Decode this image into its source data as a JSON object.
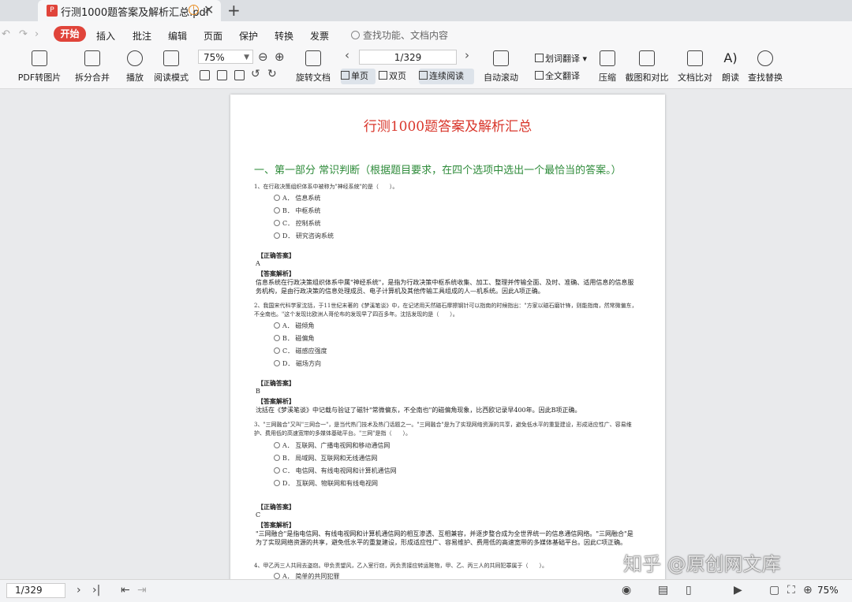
{
  "tab": {
    "title": "行测1000题答案及解析汇总.pdf",
    "pdf_icon": "P",
    "warn_icon": "!",
    "close_icon": "✕",
    "new_tab_icon": "+"
  },
  "menu": {
    "start": "开始",
    "items": [
      "插入",
      "批注",
      "编辑",
      "页面",
      "保护",
      "转换",
      "发票"
    ],
    "search_placeholder": "查找功能、文档内容"
  },
  "toolbar": {
    "pdf_to_image": "PDF转图片",
    "split_merge": "拆分合并",
    "play": "播放",
    "read_mode": "阅读模式",
    "zoom": "75%",
    "rotate_doc": "旋转文档",
    "page_indicator": "1/329",
    "single_page": "单页",
    "double_page": "双页",
    "continuous": "连续阅读",
    "auto_scroll": "自动滚动",
    "word_translate": "划词翻译",
    "full_translate": "全文翻译",
    "compress": "压缩",
    "screenshot_compare": "截图和对比",
    "doc_compare": "文档比对",
    "read_aloud": "朗读",
    "find_replace": "查找替换"
  },
  "document": {
    "title": "行测1000题答案及解析汇总",
    "section": "一、第一部分 常识判断（根据题目要求，在四个选项中选出一个最恰当的答案。）",
    "answer_label": "【正确答案】",
    "explain_label": "【答案解析】",
    "questions": [
      {
        "text": "1、在行政决策组织体系中被称为\"神经系统\"的是（　　）。",
        "options": [
          "A． 信息系统",
          "B． 中枢系统",
          "C． 控制系统",
          "D． 研究咨询系统"
        ],
        "answer": "A",
        "explanation": "信息系统在行政决策组织体系中属\"神经系统\"，是指为行政决策中枢系统收集、加工、整理并传输全面、及时、准确、适用信息的信息服务机构，是由行政决策的信息处理成员、电子计算机及其他传输工具组成的人—机系统。因此A项正确。"
      },
      {
        "text": "2、我国宋代科学家沈括，于11世纪末著的《梦溪笔谈》中，在记述用天然磁石摩擦钢针可以指南的时候指出：\"方家以磁石磨针锋，则能指南，然常微偏东，不全南也。\"这个发现比欧洲人哥伦布的发现早了四百多年。沈括发现的是（　　）。",
        "options": [
          "A． 磁倾角",
          "B． 磁偏角",
          "C． 磁感应强度",
          "D． 磁场方向"
        ],
        "answer": "B",
        "explanation": "沈括在《梦溪笔谈》中记载与验证了磁针\"常微偏东，不全南也\"的磁偏角现象，比西欧记录早400年。因此B项正确。"
      },
      {
        "text": "3、\"三网融合\"又叫\"三网合一\"，是当代热门技术及热门话题之一。\"三网融合\"是为了实现网络资源的共享，避免低水平的重复建设，形成适应性广、容易维护、费用低的高速宽带的多媒体基础平台。\"三网\"是指（　　）。",
        "options": [
          "A． 互联网、广播电视网和移动通信网",
          "B． 局域网、互联网和无线通信网",
          "C． 电信网、有线电视网和计算机通信网",
          "D． 互联网、物联网和有线电视网"
        ],
        "answer": "C",
        "explanation": "\"三网融合\"是指电信网、有线电视网和计算机通信网的相互渗透、互相兼容，并逐步整合成为全世界统一的信息通信网络。\"三网融合\"是为了实现网络资源的共享，避免低水平的重复建设，形成适应性广、容易维护、费用低的高速宽带的多媒体基础平台。因此C项正确。"
      },
      {
        "text": "4、甲乙丙三人共同去盗窃。甲负责望风，乙入室行窃，丙负责接应转运赃物，甲、乙、丙三人的共同犯罪属于（　　）。",
        "options": [
          "A． 简单的共同犯罪"
        ]
      }
    ]
  },
  "statusbar": {
    "page": "1/329",
    "zoom": "75%"
  },
  "watermark": "知乎 @原创网文库"
}
